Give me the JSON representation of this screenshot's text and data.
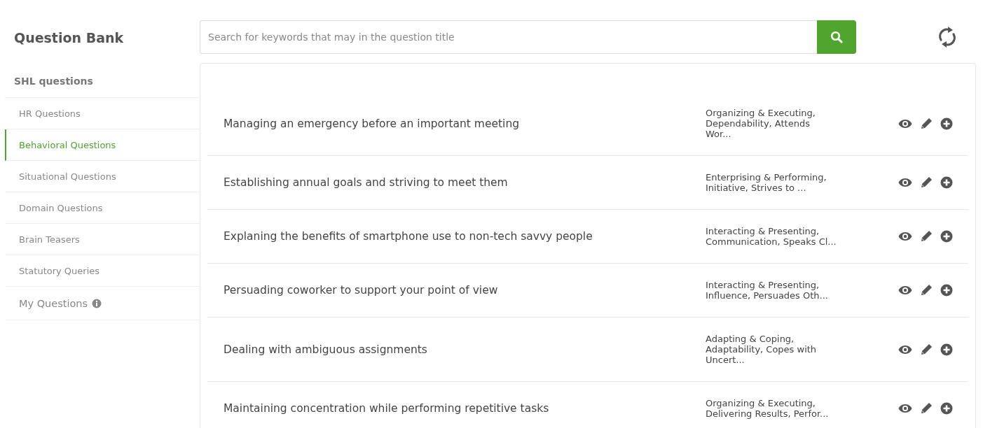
{
  "sidebar": {
    "title": "Question Bank",
    "section": "SHL questions",
    "items": [
      {
        "label": "HR Questions",
        "selected": false,
        "kind": "plain"
      },
      {
        "label": "Behavioral Questions",
        "selected": true,
        "kind": "plain"
      },
      {
        "label": "Situational Questions",
        "selected": false,
        "kind": "plain"
      },
      {
        "label": "Domain Questions",
        "selected": false,
        "kind": "plain"
      },
      {
        "label": "Brain Teasers",
        "selected": false,
        "kind": "plain"
      },
      {
        "label": "Statutory Queries",
        "selected": false,
        "kind": "plain"
      },
      {
        "label": "My Questions",
        "selected": false,
        "kind": "info"
      }
    ]
  },
  "search": {
    "placeholder": "Search for keywords that may in the question title"
  },
  "questions": [
    {
      "title": "Managing an emergency before an important meeting",
      "tags": "Organizing & Executing,\nDependability, Attends\nWor..."
    },
    {
      "title": "Establishing annual goals and striving to meet them",
      "tags": "Enterprising & Performing,\nInitiative, Strives to ..."
    },
    {
      "title": "Explaning the benefits of smartphone use to non-tech savvy people",
      "tags": "Interacting & Presenting,\nCommunication, Speaks Cl..."
    },
    {
      "title": "Persuading coworker to support your point of view",
      "tags": "Interacting & Presenting,\nInfluence, Persuades Oth..."
    },
    {
      "title": "Dealing with ambiguous assignments",
      "tags": "Adapting & Coping,\nAdaptability, Copes with\nUncert..."
    },
    {
      "title": "Maintaining concentration while performing repetitive tasks",
      "tags": "Organizing & Executing,\nDelivering Results, Perfor..."
    }
  ]
}
